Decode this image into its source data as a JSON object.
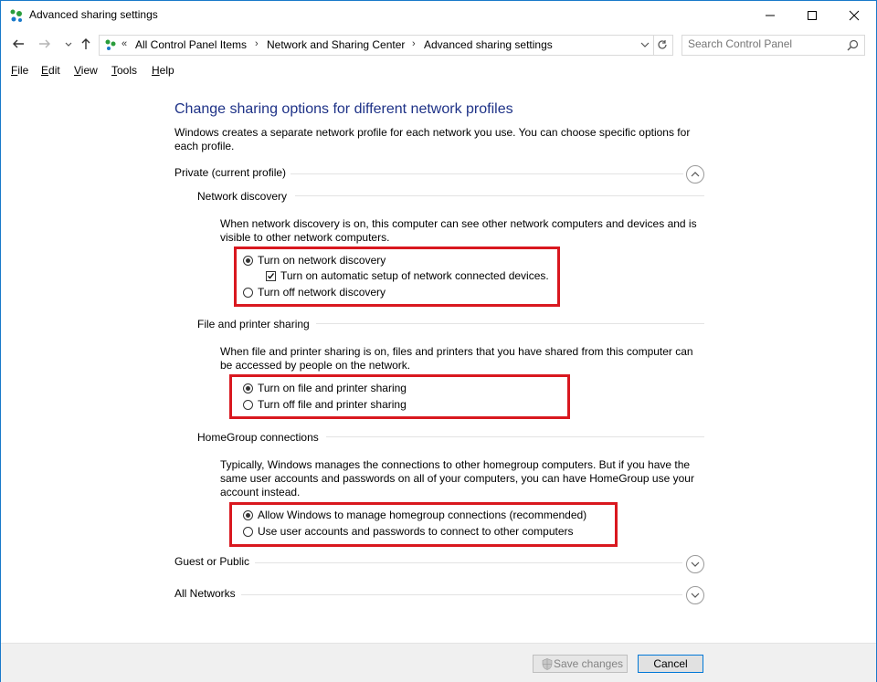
{
  "window": {
    "title": "Advanced sharing settings"
  },
  "address": {
    "overflow": "«",
    "crumbs": [
      "All Control Panel Items",
      "Network and Sharing Center",
      "Advanced sharing settings"
    ],
    "separator": "›"
  },
  "search": {
    "placeholder": "Search Control Panel"
  },
  "menu": [
    {
      "label": "File",
      "accel": "F",
      "rest": "ile"
    },
    {
      "label": "Edit",
      "accel": "E",
      "rest": "dit"
    },
    {
      "label": "View",
      "accel": "V",
      "rest": "iew"
    },
    {
      "label": "Tools",
      "accel": "T",
      "rest": "ools"
    },
    {
      "label": "Help",
      "accel": "H",
      "rest": "elp"
    }
  ],
  "page": {
    "heading": "Change sharing options for different network profiles",
    "intro": "Windows creates a separate network profile for each network you use. You can choose specific options for each profile."
  },
  "private": {
    "label": "Private (current profile)",
    "network_discovery": {
      "title": "Network discovery",
      "desc": "When network discovery is on, this computer can see other network computers and devices and is visible to other network computers.",
      "on_label": "Turn on network discovery",
      "auto_setup_label": "Turn on automatic setup of network connected devices.",
      "off_label": "Turn off network discovery"
    },
    "file_sharing": {
      "title": "File and printer sharing",
      "desc": "When file and printer sharing is on, files and printers that you have shared from this computer can be accessed by people on the network.",
      "on_label": "Turn on file and printer sharing",
      "off_label": "Turn off file and printer sharing"
    },
    "homegroup": {
      "title": "HomeGroup connections",
      "desc": "Typically, Windows manages the connections to other homegroup computers. But if you have the same user accounts and passwords on all of your computers, you can have HomeGroup use your account instead.",
      "allow_label": "Allow Windows to manage homegroup connections (recommended)",
      "user_label": "Use user accounts and passwords to connect to other computers"
    }
  },
  "guest": {
    "label": "Guest or Public"
  },
  "all_networks": {
    "label": "All Networks"
  },
  "buttons": {
    "save": "Save changes",
    "cancel": "Cancel"
  },
  "colors": {
    "heading": "#1e3287",
    "highlight": "#d9181f",
    "accent": "#0078d7"
  }
}
